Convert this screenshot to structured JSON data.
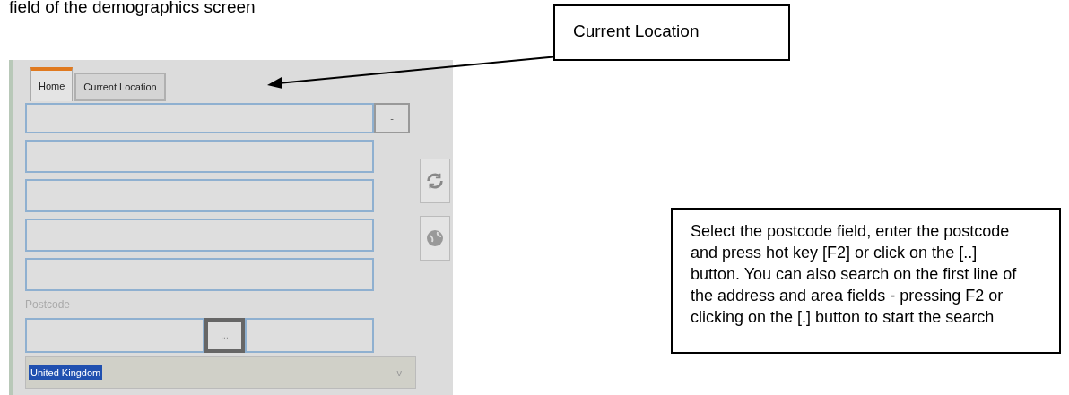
{
  "heading": "field of the demographics screen",
  "screen": {
    "tabs": [
      {
        "label": "Home",
        "selected": true
      },
      {
        "label": "Current Location",
        "selected": false
      }
    ],
    "dropdown_button": "-",
    "address_fields": [
      {
        "kind": "text"
      },
      {
        "kind": "text"
      },
      {
        "kind": "text"
      },
      {
        "kind": "text"
      }
    ],
    "postcode": {
      "label": "Postcode",
      "button": "..."
    },
    "country": {
      "value": "United Kingdom",
      "selected": true,
      "arrow": "v"
    }
  },
  "callouts": [
    "Current Location",
    "Select the postcode field, enter the postcode and press hot key [F2] or click on the [..] button. You can also search on the first line of the address and area fields - pressing F2 or clicking on the [.] button to start the search"
  ]
}
